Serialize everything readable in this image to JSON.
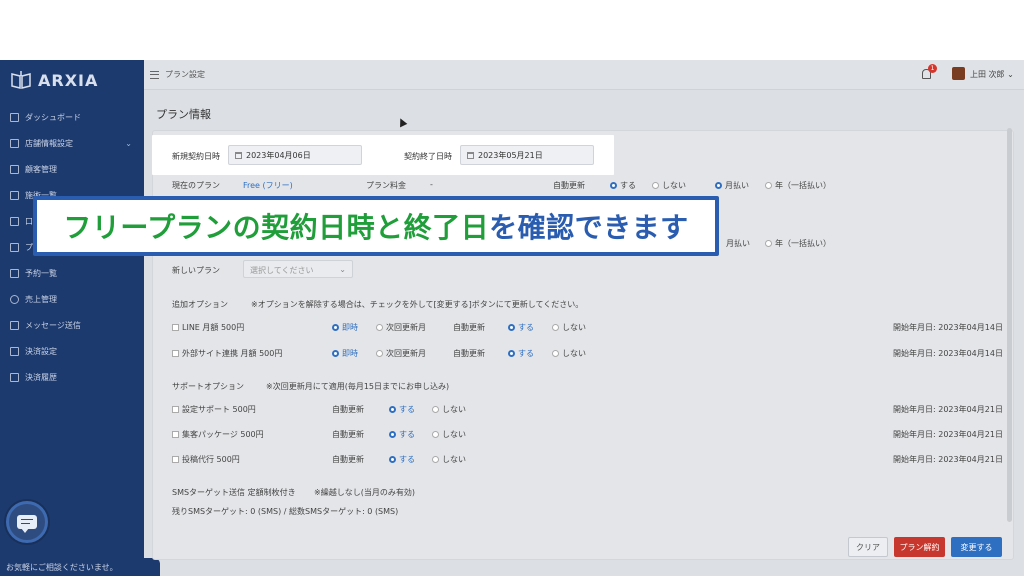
{
  "app": {
    "logo_text": "ARXIA"
  },
  "topbar": {
    "breadcrumb": "プラン設定",
    "notification_count": "1",
    "user_name": "上田 次郎"
  },
  "sidebar": {
    "items": [
      {
        "label": "ダッシュボード"
      },
      {
        "label": "店舗情報設定"
      },
      {
        "label": "顧客管理"
      },
      {
        "label": "施術一覧"
      },
      {
        "label": "口"
      },
      {
        "label": "プ"
      },
      {
        "label": "予約一覧"
      },
      {
        "label": "売上管理"
      },
      {
        "label": "メッセージ送信"
      },
      {
        "label": "決済設定"
      },
      {
        "label": "決済履歴"
      }
    ],
    "help_text": "お気軽にご相談くださいませ。"
  },
  "page": {
    "title": "プラン情報"
  },
  "contract": {
    "start_label": "新規契約日時",
    "start_value": "2023年04月06日",
    "end_label": "契約終了日時",
    "end_value": "2023年05月21日"
  },
  "current_plan": {
    "label": "現在のプラン",
    "value": "Free (フリー)",
    "fee_label": "プラン料金",
    "fee_value": "-",
    "auto_renew_label": "自動更新",
    "renew_on": "する",
    "renew_off": "しない",
    "pay_monthly": "月払い",
    "pay_yearly": "年（一括払い）"
  },
  "new_plan": {
    "label": "新しいプラン",
    "placeholder": "選択してください",
    "pay_monthly": "月払い",
    "pay_yearly": "年（一括払い）"
  },
  "options": {
    "title": "追加オプション",
    "note": "※オプションを解除する場合は、チェックを外して[変更する]ボタンにて更新してください。",
    "items": [
      {
        "name": "LINE 月額 500円",
        "immediate": "即時",
        "next": "次回更新月",
        "auto_label": "自動更新",
        "on": "する",
        "off": "しない",
        "start": "開始年月日: 2023年04月14日"
      },
      {
        "name": "外部サイト連携 月額 500円",
        "immediate": "即時",
        "next": "次回更新月",
        "auto_label": "自動更新",
        "on": "する",
        "off": "しない",
        "start": "開始年月日: 2023年04月14日"
      }
    ]
  },
  "support": {
    "title": "サポートオプション",
    "note": "※次回更新月にて適用(毎月15日までにお申し込み)",
    "items": [
      {
        "name": "設定サポート 500円",
        "auto_label": "自動更新",
        "on": "する",
        "off": "しない",
        "start": "開始年月日: 2023年04月21日"
      },
      {
        "name": "集客パッケージ 500円",
        "auto_label": "自動更新",
        "on": "する",
        "off": "しない",
        "start": "開始年月日: 2023年04月21日"
      },
      {
        "name": "投稿代行 500円",
        "auto_label": "自動更新",
        "on": "する",
        "off": "しない",
        "start": "開始年月日: 2023年04月21日"
      }
    ]
  },
  "sms": {
    "label": "SMSターゲット送信 定額制枚付き",
    "note": "※繰越しなし(当月のみ有効)",
    "remaining": "残りSMSターゲット: 0 (SMS) / 総数SMSターゲット: 0 (SMS)"
  },
  "buttons": {
    "clear": "クリア",
    "cancel_plan": "プラン解約",
    "change": "変更する"
  },
  "banner": {
    "part1": "フリープランの契約日時と終了日",
    "part2": "を確認できます"
  },
  "colors": {
    "sidebar": "#1d3a6e",
    "accent": "#2f6fc2",
    "danger": "#c8372d",
    "banner_green": "#1f9e3a",
    "banner_blue": "#2a5db0"
  }
}
